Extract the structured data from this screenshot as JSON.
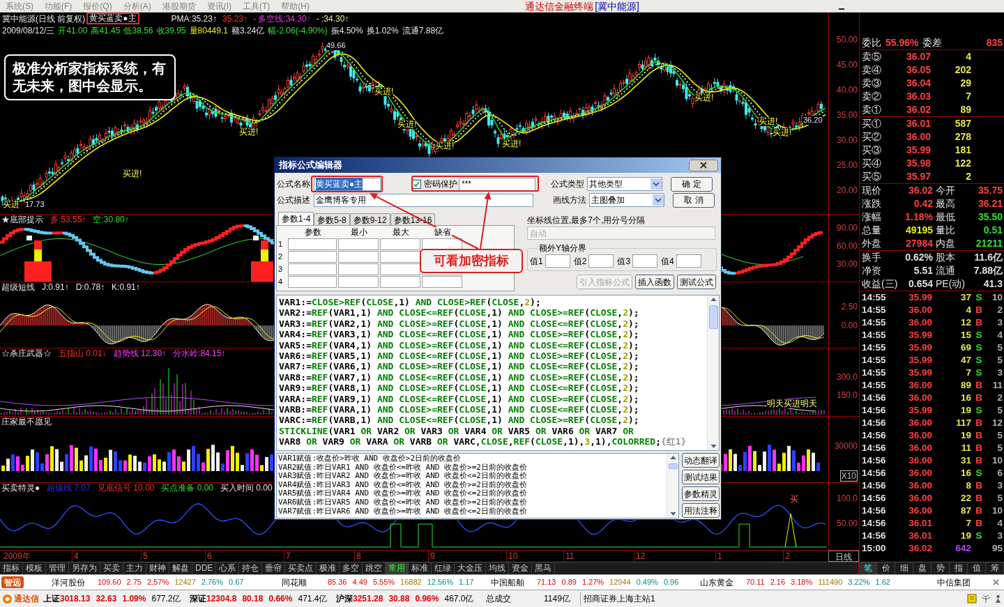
{
  "menu_bar": {
    "items": [
      "系统(S)",
      "功能(F)",
      "报价(Q)",
      "分析(A)",
      "港股期货",
      "资讯(I)",
      "工具(T)",
      "帮助(H)"
    ],
    "app_title": "通达信金融终端",
    "stock_title": "[冀中能源]"
  },
  "main_chart": {
    "title": "冀中能源(日线 前复权)",
    "formula_tag": "黄买蓝卖●主",
    "indicators": [
      {
        "text": "PMA:35.23↑",
        "color": "#e8e8e8"
      },
      {
        "text": "35.23↑",
        "color": "#ff3030"
      },
      {
        "text": "- 多空线:34.30↑",
        "color": "#e040e0"
      },
      {
        "text": "- :34.30↑",
        "color": "#f0f0a0"
      }
    ],
    "quote": [
      {
        "text": "2009/08/12/三",
        "color": "#e8e8e8"
      },
      {
        "text": "开41.00",
        "color": "#30e030"
      },
      {
        "text": "高41.45",
        "color": "#30e030"
      },
      {
        "text": "低38.56",
        "color": "#30e030"
      },
      {
        "text": "收39.95",
        "color": "#30e030"
      },
      {
        "text": "量80449.1",
        "color": "#f0f000"
      },
      {
        "text": "额3.24亿",
        "color": "#e8e8e8"
      },
      {
        "text": "幅-2.06(-4.90%)",
        "color": "#30e030"
      },
      {
        "text": "振4.50%",
        "color": "#e8e8e8"
      },
      {
        "text": "换1.02%",
        "color": "#e8e8e8"
      },
      {
        "text": "流通7.88亿",
        "color": "#e8e8e8"
      }
    ],
    "price_marks": [
      "49.66",
      "17.73",
      "36.20"
    ],
    "signals": [
      "买进!",
      "买进!",
      "买进!",
      "买进!",
      "买进!",
      "买进!",
      "买进!",
      "买进!",
      "买进!",
      "买进"
    ],
    "axis": [
      "50.00",
      "45.00",
      "40.00",
      "35.00",
      "30.00",
      "25.00",
      "20.00"
    ],
    "callout": "极准分析家指标系统，有无未来，图中会显示。"
  },
  "panels": [
    {
      "kind": "bottom",
      "title": "★底部提示",
      "values": [
        {
          "text": "多:53.55↑",
          "color": "#ff3030"
        },
        {
          "text": "空:30.80↑",
          "color": "#30e030"
        }
      ],
      "axis": [
        "90.00",
        "60.00",
        "30.00"
      ]
    },
    {
      "kind": "oscillator",
      "title": "超级短线",
      "values": [
        {
          "text": "J:0.91↑",
          "color": "#e8e8e8"
        },
        {
          "text": "D:0.78↑",
          "color": "#e8e8e8"
        },
        {
          "text": "K:0.91↑",
          "color": "#e8e8e8"
        }
      ],
      "axis": [
        "2.50",
        "0.00"
      ]
    },
    {
      "kind": "spikes",
      "title": "☆杀庄武器☆",
      "values": [
        {
          "text": "五指山 0.01↓",
          "color": "#ff3030"
        },
        {
          "text": "趋势线 12.30↑",
          "color": "#ff40ff"
        },
        {
          "text": "分水岭:84.15↑",
          "color": "#ff40ff"
        }
      ],
      "axis": [
        "300.0",
        "150.0"
      ],
      "labels": [
        "明天买进明天"
      ]
    },
    {
      "kind": "volume",
      "title": "庄家最不愿见",
      "axis": [
        "30000",
        "X10"
      ]
    },
    {
      "kind": "wave",
      "title": "买卖特灵●",
      "values": [
        {
          "text": "超级线 7.07",
          "color": "#2838e0"
        },
        {
          "text": "见底信号 10.00",
          "color": "#ff3030"
        },
        {
          "text": "买点准备 0.00",
          "color": "#30e030"
        },
        {
          "text": "买入时间 0.00",
          "color": "#e8e8e8"
        }
      ],
      "axis": [
        "100.0",
        "50.00"
      ],
      "labels": [
        "买"
      ]
    }
  ],
  "x_axis": {
    "year": "2009年",
    "months": [
      "4",
      "5",
      "6",
      "7",
      "8",
      "9",
      "10",
      "11",
      "12",
      "1",
      "2"
    ],
    "period": "日线"
  },
  "quote_panel": {
    "ratio_label": "委比",
    "ratio": "55.96%",
    "diff_label": "委差",
    "diff": "835",
    "asks": [
      {
        "label": "卖⑤",
        "price": "36.07",
        "volume": "4"
      },
      {
        "label": "卖④",
        "price": "36.05",
        "volume": "202"
      },
      {
        "label": "卖③",
        "price": "36.04",
        "volume": "29"
      },
      {
        "label": "卖②",
        "price": "36.03",
        "volume": "7"
      },
      {
        "label": "卖①",
        "price": "36.02",
        "volume": "89"
      }
    ],
    "bids": [
      {
        "label": "买①",
        "price": "36.01",
        "volume": "587"
      },
      {
        "label": "买②",
        "price": "36.00",
        "volume": "278"
      },
      {
        "label": "买③",
        "price": "35.99",
        "volume": "181"
      },
      {
        "label": "买④",
        "price": "35.98",
        "volume": "122"
      },
      {
        "label": "买⑤",
        "price": "35.97",
        "volume": "2"
      }
    ],
    "stats": [
      {
        "label": "现价",
        "value": "36.02",
        "color": "#ff4040"
      },
      {
        "label": "今开",
        "value": "35.75",
        "color": "#ff4040"
      },
      {
        "label": "涨跌",
        "value": "0.42",
        "color": "#ff4040"
      },
      {
        "label": "最高",
        "value": "36.21",
        "color": "#ff4040"
      },
      {
        "label": "涨幅",
        "value": "1.18%",
        "color": "#ff4040"
      },
      {
        "label": "最低",
        "value": "35.50",
        "color": "#30e030"
      },
      {
        "label": "总量",
        "value": "49195",
        "color": "#f0f000"
      },
      {
        "label": "量比",
        "value": "0.51",
        "color": "#30e030"
      },
      {
        "label": "外盘",
        "value": "27984",
        "color": "#ff4040"
      },
      {
        "label": "内盘",
        "value": "21211",
        "color": "#30e030"
      }
    ],
    "fundamentals": [
      {
        "label": "换手",
        "value": "0.62%"
      },
      {
        "label": "股本",
        "value": "11.6亿"
      },
      {
        "label": "净资",
        "value": "5.51"
      },
      {
        "label": "流通",
        "value": "7.88亿"
      },
      {
        "label": "收益(三)",
        "value": "0.654"
      },
      {
        "label": "PE(动)",
        "value": "41.3"
      }
    ],
    "trades": [
      {
        "time": "14:55",
        "price": "35.99",
        "volume": "37",
        "side": "S",
        "count": "10",
        "kind": "sell"
      },
      {
        "time": "14:55",
        "price": "36.00",
        "volume": "4",
        "side": "B",
        "count": "2",
        "kind": "buy"
      },
      {
        "time": "14:55",
        "price": "36.00",
        "volume": "12",
        "side": "B",
        "count": "3",
        "kind": "buy"
      },
      {
        "time": "14:55",
        "price": "35.99",
        "volume": "15",
        "side": "S",
        "count": "4",
        "kind": "sell"
      },
      {
        "time": "14:55",
        "price": "35.99",
        "volume": "69",
        "side": "S",
        "count": "5",
        "kind": "sell"
      },
      {
        "time": "14:55",
        "price": "35.99",
        "volume": "47",
        "side": "S",
        "count": "5",
        "kind": "sell"
      },
      {
        "time": "14:55",
        "price": "35.99",
        "volume": "7",
        "side": "S",
        "count": "3",
        "kind": "sell"
      },
      {
        "time": "14:55",
        "price": "36.00",
        "volume": "89",
        "side": "B",
        "count": "11",
        "kind": "buy"
      },
      {
        "time": "14:56",
        "price": "36.00",
        "volume": "16",
        "side": "B",
        "count": "2",
        "kind": "buy"
      },
      {
        "time": "14:56",
        "price": "35.99",
        "volume": "19",
        "side": "S",
        "count": "5",
        "kind": "sell"
      },
      {
        "time": "14:56",
        "price": "36.00",
        "volume": "117",
        "side": "B",
        "count": "12",
        "kind": "buy"
      },
      {
        "time": "14:56",
        "price": "36.00",
        "volume": "19",
        "side": "B",
        "count": "5",
        "kind": "buy"
      },
      {
        "time": "14:56",
        "price": "36.00",
        "volume": "11",
        "side": "B",
        "count": "5",
        "kind": "buy"
      },
      {
        "time": "14:56",
        "price": "36.00",
        "volume": "31",
        "side": "B",
        "count": "10",
        "kind": "buy"
      },
      {
        "time": "14:56",
        "price": "36.00",
        "volume": "16",
        "side": "S",
        "count": "6",
        "kind": "sell"
      },
      {
        "time": "14:56",
        "price": "36.00",
        "volume": "8",
        "side": "B",
        "count": "3",
        "kind": "buy"
      },
      {
        "time": "14:56",
        "price": "36.00",
        "volume": "22",
        "side": "B",
        "count": "5",
        "kind": "buy"
      },
      {
        "time": "14:56",
        "price": "36.00",
        "volume": "87",
        "side": "B",
        "count": "10",
        "kind": "buy"
      },
      {
        "time": "14:56",
        "price": "36.01",
        "volume": "7",
        "side": "B",
        "count": "4",
        "kind": "buy"
      },
      {
        "time": "14:56",
        "price": "36.01",
        "volume": "19",
        "side": "S",
        "count": "3",
        "kind": "sell"
      },
      {
        "time": "15:00",
        "price": "36.02",
        "volume": "642",
        "count": "95",
        "kind": "total"
      }
    ],
    "tabs": [
      {
        "label": "笔",
        "selected": true
      },
      {
        "label": "价",
        "selected": false
      },
      {
        "label": "细",
        "selected": false
      },
      {
        "label": "盘",
        "selected": false
      },
      {
        "label": "势",
        "selected": false
      },
      {
        "label": "指",
        "selected": false
      },
      {
        "label": "值",
        "selected": false
      },
      {
        "label": "筹",
        "selected": false
      }
    ]
  },
  "bottom_tabs": [
    {
      "label": "指标",
      "selected": false
    },
    {
      "label": "模板",
      "selected": false
    },
    {
      "label": "管理",
      "selected": false
    },
    {
      "label": "另存为",
      "selected": false
    },
    {
      "label": "买卖",
      "selected": false
    },
    {
      "label": "主力",
      "selected": false
    },
    {
      "label": "财神",
      "selected": false
    },
    {
      "label": "解盘",
      "selected": false
    },
    {
      "label": "DDE",
      "selected": false
    },
    {
      "label": "心系",
      "selected": false
    },
    {
      "label": "持仓",
      "selected": false
    },
    {
      "label": "垂帘",
      "selected": false
    },
    {
      "label": "买卖点",
      "selected": false
    },
    {
      "label": "极准",
      "selected": false
    },
    {
      "label": "多空",
      "selected": false
    },
    {
      "label": "跳空",
      "selected": false
    },
    {
      "label": "常用",
      "selected": true
    },
    {
      "label": "标准",
      "selected": false
    },
    {
      "label": "红绿",
      "selected": false
    },
    {
      "label": "大金压",
      "selected": false
    },
    {
      "label": "均线",
      "selected": false
    },
    {
      "label": "资金",
      "selected": false
    },
    {
      "label": "黑马",
      "selected": false
    }
  ],
  "ticker": {
    "logo": "智远",
    "items": [
      {
        "name": "洋河股份",
        "values": [
          "109.60",
          "2.75",
          "2.57%",
          "12427",
          "2.76%",
          "0.67"
        ]
      },
      {
        "name": "同花顺",
        "values": [
          "85.36",
          "4.49",
          "5.55%",
          "16882",
          "12.56%",
          "1.17"
        ]
      },
      {
        "name": "中国船舶",
        "values": [
          "71.13",
          "0.89",
          "1.27%",
          "12944",
          "0.49%",
          "0.96"
        ]
      },
      {
        "name": "山东黄金",
        "values": [
          "70.11",
          "2.16",
          "3.18%",
          "111490",
          "3.22%",
          "1.62"
        ]
      },
      {
        "name": "中信集团"
      }
    ]
  },
  "status_bar": {
    "logo": "通达信",
    "indices": [
      {
        "name": "上证",
        "value": "3018.13",
        "change": "32.63",
        "percent": "1.09%",
        "amount": "677.2亿"
      },
      {
        "name": "深证",
        "value": "12304.8",
        "change": "80.18",
        "percent": "0.66%",
        "amount": "471.4亿"
      },
      {
        "name": "沪深",
        "value": "3251.28",
        "change": "30.88",
        "percent": "0.96%",
        "amount": "467.0亿"
      }
    ],
    "total_label": "总成交",
    "total": "1149亿",
    "server": "招商证券上海主站1"
  },
  "dialog": {
    "title": "指标公式编辑器",
    "name": {
      "label": "公式名称",
      "value": "黄买蓝卖●主",
      "text_selected": true
    },
    "password": {
      "label": "密码保护",
      "checked": true,
      "value": "***"
    },
    "type": {
      "label": "公式类型",
      "value": "其他类型"
    },
    "description": {
      "label": "公式描述",
      "value": "金鹰博客专用"
    },
    "draw_method": {
      "label": "画线方法",
      "value": "主图叠加"
    },
    "buttons": [
      "确 定",
      "取 消"
    ],
    "param_tabs": [
      {
        "label": "参数1-4",
        "selected": true
      },
      {
        "label": "参数5-8",
        "selected": false
      },
      {
        "label": "参数9-12",
        "selected": false
      },
      {
        "label": "参数13-16",
        "selected": false
      }
    ],
    "param_headers": [
      "参数",
      "最小",
      "最大",
      "缺省"
    ],
    "param_rows": [
      "1",
      "2",
      "3",
      "4"
    ],
    "axis_label": "坐标线位置,最多7个,用分号分隔",
    "axis_placeholder": "自动",
    "y_group": {
      "title": "额外Y轴分界",
      "fields": [
        "值1",
        "值2",
        "值3",
        "值4"
      ]
    },
    "actions": [
      {
        "label": "引入指标公式",
        "disabled": true
      },
      {
        "label": "插入函数",
        "disabled": false
      },
      {
        "label": "测试公式",
        "disabled": false
      }
    ],
    "code": [
      [
        {
          "text": "VAR1:=",
          "kind": "plain"
        },
        {
          "text": "CLOSE>REF",
          "kind": "keyword"
        },
        {
          "text": "(",
          "kind": "plain"
        },
        {
          "text": "CLOSE",
          "kind": "keyword"
        },
        {
          "text": ",1) ",
          "kind": "plain"
        },
        {
          "text": "AND CLOSE>REF",
          "kind": "keyword"
        },
        {
          "text": "(",
          "kind": "plain"
        },
        {
          "text": "CLOSE",
          "kind": "keyword"
        },
        {
          "text": ",",
          "kind": "plain"
        },
        {
          "text": "2",
          "kind": "number"
        },
        {
          "text": ");",
          "kind": "plain"
        }
      ],
      [
        {
          "text": "VAR2:=",
          "kind": "plain"
        },
        {
          "text": "REF",
          "kind": "keyword"
        },
        {
          "text": "(VAR1,1) ",
          "kind": "plain"
        },
        {
          "text": "AND CLOSE<=REF",
          "kind": "keyword"
        },
        {
          "text": "(",
          "kind": "plain"
        },
        {
          "text": "CLOSE",
          "kind": "keyword"
        },
        {
          "text": ",1) ",
          "kind": "plain"
        },
        {
          "text": "AND CLOSE>=REF",
          "kind": "keyword"
        },
        {
          "text": "(",
          "kind": "plain"
        },
        {
          "text": "CLOSE",
          "kind": "keyword"
        },
        {
          "text": ",",
          "kind": "plain"
        },
        {
          "text": "2",
          "kind": "number"
        },
        {
          "text": ");",
          "kind": "plain"
        }
      ],
      [
        {
          "text": "VAR3:=",
          "kind": "plain"
        },
        {
          "text": "REF",
          "kind": "keyword"
        },
        {
          "text": "(VAR2,1) ",
          "kind": "plain"
        },
        {
          "text": "AND CLOSE>=REF",
          "kind": "keyword"
        },
        {
          "text": "(",
          "kind": "plain"
        },
        {
          "text": "CLOSE",
          "kind": "keyword"
        },
        {
          "text": ",1) ",
          "kind": "plain"
        },
        {
          "text": "AND CLOSE<=REF",
          "kind": "keyword"
        },
        {
          "text": "(",
          "kind": "plain"
        },
        {
          "text": "CLOSE",
          "kind": "keyword"
        },
        {
          "text": ",",
          "kind": "plain"
        },
        {
          "text": "2",
          "kind": "number"
        },
        {
          "text": ");",
          "kind": "plain"
        }
      ],
      [
        {
          "text": "VAR4:=",
          "kind": "plain"
        },
        {
          "text": "REF",
          "kind": "keyword"
        },
        {
          "text": "(VAR3,1) ",
          "kind": "plain"
        },
        {
          "text": "AND CLOSE<=REF",
          "kind": "keyword"
        },
        {
          "text": "(",
          "kind": "plain"
        },
        {
          "text": "CLOSE",
          "kind": "keyword"
        },
        {
          "text": ",1) ",
          "kind": "plain"
        },
        {
          "text": "AND CLOSE>=REF",
          "kind": "keyword"
        },
        {
          "text": "(",
          "kind": "plain"
        },
        {
          "text": "CLOSE",
          "kind": "keyword"
        },
        {
          "text": ",",
          "kind": "plain"
        },
        {
          "text": "2",
          "kind": "number"
        },
        {
          "text": ");",
          "kind": "plain"
        }
      ],
      [
        {
          "text": "VAR5:=",
          "kind": "plain"
        },
        {
          "text": "REF",
          "kind": "keyword"
        },
        {
          "text": "(VAR4,1) ",
          "kind": "plain"
        },
        {
          "text": "AND CLOSE>=REF",
          "kind": "keyword"
        },
        {
          "text": "(",
          "kind": "plain"
        },
        {
          "text": "CLOSE",
          "kind": "keyword"
        },
        {
          "text": ",1) ",
          "kind": "plain"
        },
        {
          "text": "AND CLOSE<=REF",
          "kind": "keyword"
        },
        {
          "text": "(",
          "kind": "plain"
        },
        {
          "text": "CLOSE",
          "kind": "keyword"
        },
        {
          "text": ",",
          "kind": "plain"
        },
        {
          "text": "2",
          "kind": "number"
        },
        {
          "text": ");",
          "kind": "plain"
        }
      ],
      [
        {
          "text": "VAR6:=",
          "kind": "plain"
        },
        {
          "text": "REF",
          "kind": "keyword"
        },
        {
          "text": "(VAR5,1) ",
          "kind": "plain"
        },
        {
          "text": "AND CLOSE<=REF",
          "kind": "keyword"
        },
        {
          "text": "(",
          "kind": "plain"
        },
        {
          "text": "CLOSE",
          "kind": "keyword"
        },
        {
          "text": ",1) ",
          "kind": "plain"
        },
        {
          "text": "AND CLOSE>=REF",
          "kind": "keyword"
        },
        {
          "text": "(",
          "kind": "plain"
        },
        {
          "text": "CLOSE",
          "kind": "keyword"
        },
        {
          "text": ",",
          "kind": "plain"
        },
        {
          "text": "2",
          "kind": "number"
        },
        {
          "text": ");",
          "kind": "plain"
        }
      ],
      [
        {
          "text": "VAR7:=",
          "kind": "plain"
        },
        {
          "text": "REF",
          "kind": "keyword"
        },
        {
          "text": "(VAR6,1) ",
          "kind": "plain"
        },
        {
          "text": "AND CLOSE>=REF",
          "kind": "keyword"
        },
        {
          "text": "(",
          "kind": "plain"
        },
        {
          "text": "CLOSE",
          "kind": "keyword"
        },
        {
          "text": ",1) ",
          "kind": "plain"
        },
        {
          "text": "AND CLOSE<=REF",
          "kind": "keyword"
        },
        {
          "text": "(",
          "kind": "plain"
        },
        {
          "text": "CLOSE",
          "kind": "keyword"
        },
        {
          "text": ",",
          "kind": "plain"
        },
        {
          "text": "2",
          "kind": "number"
        },
        {
          "text": ");",
          "kind": "plain"
        }
      ],
      [
        {
          "text": "VAR8:=",
          "kind": "plain"
        },
        {
          "text": "REF",
          "kind": "keyword"
        },
        {
          "text": "(VAR7,1) ",
          "kind": "plain"
        },
        {
          "text": "AND CLOSE<=REF",
          "kind": "keyword"
        },
        {
          "text": "(",
          "kind": "plain"
        },
        {
          "text": "CLOSE",
          "kind": "keyword"
        },
        {
          "text": ",1) ",
          "kind": "plain"
        },
        {
          "text": "AND CLOSE>=REF",
          "kind": "keyword"
        },
        {
          "text": "(",
          "kind": "plain"
        },
        {
          "text": "CLOSE",
          "kind": "keyword"
        },
        {
          "text": ",",
          "kind": "plain"
        },
        {
          "text": "2",
          "kind": "number"
        },
        {
          "text": ");",
          "kind": "plain"
        }
      ],
      [
        {
          "text": "VAR9:=",
          "kind": "plain"
        },
        {
          "text": "REF",
          "kind": "keyword"
        },
        {
          "text": "(VAR8,1) ",
          "kind": "plain"
        },
        {
          "text": "AND CLOSE>=REF",
          "kind": "keyword"
        },
        {
          "text": "(",
          "kind": "plain"
        },
        {
          "text": "CLOSE",
          "kind": "keyword"
        },
        {
          "text": ",1) ",
          "kind": "plain"
        },
        {
          "text": "AND CLOSE<=REF",
          "kind": "keyword"
        },
        {
          "text": "(",
          "kind": "plain"
        },
        {
          "text": "CLOSE",
          "kind": "keyword"
        },
        {
          "text": ",",
          "kind": "plain"
        },
        {
          "text": "2",
          "kind": "number"
        },
        {
          "text": ");",
          "kind": "plain"
        }
      ],
      [
        {
          "text": "VARA:=",
          "kind": "plain"
        },
        {
          "text": "REF",
          "kind": "keyword"
        },
        {
          "text": "(VAR9,1) ",
          "kind": "plain"
        },
        {
          "text": "AND CLOSE<=REF",
          "kind": "keyword"
        },
        {
          "text": "(",
          "kind": "plain"
        },
        {
          "text": "CLOSE",
          "kind": "keyword"
        },
        {
          "text": ",1) ",
          "kind": "plain"
        },
        {
          "text": "AND CLOSE>=REF",
          "kind": "keyword"
        },
        {
          "text": "(",
          "kind": "plain"
        },
        {
          "text": "CLOSE",
          "kind": "keyword"
        },
        {
          "text": ",",
          "kind": "plain"
        },
        {
          "text": "2",
          "kind": "number"
        },
        {
          "text": ");",
          "kind": "plain"
        }
      ],
      [
        {
          "text": "VARB:=",
          "kind": "plain"
        },
        {
          "text": "REF",
          "kind": "keyword"
        },
        {
          "text": "(VARA,1) ",
          "kind": "plain"
        },
        {
          "text": "AND CLOSE>=REF",
          "kind": "keyword"
        },
        {
          "text": "(",
          "kind": "plain"
        },
        {
          "text": "CLOSE",
          "kind": "keyword"
        },
        {
          "text": ",1) ",
          "kind": "plain"
        },
        {
          "text": "AND CLOSE<=REF",
          "kind": "keyword"
        },
        {
          "text": "(",
          "kind": "plain"
        },
        {
          "text": "CLOSE",
          "kind": "keyword"
        },
        {
          "text": ",",
          "kind": "plain"
        },
        {
          "text": "2",
          "kind": "number"
        },
        {
          "text": ");",
          "kind": "plain"
        }
      ],
      [
        {
          "text": "VARC:=",
          "kind": "plain"
        },
        {
          "text": "REF",
          "kind": "keyword"
        },
        {
          "text": "(VARB,1) ",
          "kind": "plain"
        },
        {
          "text": "AND CLOSE<=REF",
          "kind": "keyword"
        },
        {
          "text": "(",
          "kind": "plain"
        },
        {
          "text": "CLOSE",
          "kind": "keyword"
        },
        {
          "text": ",1) ",
          "kind": "plain"
        },
        {
          "text": "AND CLOSE>=REF",
          "kind": "keyword"
        },
        {
          "text": "(",
          "kind": "plain"
        },
        {
          "text": "CLOSE",
          "kind": "keyword"
        },
        {
          "text": ",",
          "kind": "plain"
        },
        {
          "text": "2",
          "kind": "number"
        },
        {
          "text": ");",
          "kind": "plain"
        }
      ],
      [
        {
          "text": "STICKLINE",
          "kind": "keyword"
        },
        {
          "text": "(VAR1 ",
          "kind": "plain"
        },
        {
          "text": "OR",
          "kind": "keyword"
        },
        {
          "text": " VAR2 ",
          "kind": "plain"
        },
        {
          "text": "OR",
          "kind": "keyword"
        },
        {
          "text": " VAR3 ",
          "kind": "plain"
        },
        {
          "text": "OR",
          "kind": "keyword"
        },
        {
          "text": " VAR4 ",
          "kind": "plain"
        },
        {
          "text": "OR",
          "kind": "keyword"
        },
        {
          "text": " VAR5 ",
          "kind": "plain"
        },
        {
          "text": "OR",
          "kind": "keyword"
        },
        {
          "text": " VAR6 ",
          "kind": "plain"
        },
        {
          "text": "OR",
          "kind": "keyword"
        },
        {
          "text": " VAR7 ",
          "kind": "plain"
        },
        {
          "text": "OR",
          "kind": "keyword"
        }
      ],
      [
        {
          "text": "VAR8 ",
          "kind": "plain"
        },
        {
          "text": "OR",
          "kind": "keyword"
        },
        {
          "text": " VAR9 ",
          "kind": "plain"
        },
        {
          "text": "OR",
          "kind": "keyword"
        },
        {
          "text": " VARA ",
          "kind": "plain"
        },
        {
          "text": "OR",
          "kind": "keyword"
        },
        {
          "text": " VARB ",
          "kind": "plain"
        },
        {
          "text": "OR",
          "kind": "keyword"
        },
        {
          "text": " VARC,",
          "kind": "plain"
        },
        {
          "text": "CLOSE",
          "kind": "keyword"
        },
        {
          "text": ",",
          "kind": "plain"
        },
        {
          "text": "REF",
          "kind": "keyword"
        },
        {
          "text": "(",
          "kind": "plain"
        },
        {
          "text": "CLOSE",
          "kind": "keyword"
        },
        {
          "text": ",1),",
          "kind": "plain"
        },
        {
          "text": "3",
          "kind": "number"
        },
        {
          "text": ",1),",
          "kind": "plain"
        },
        {
          "text": "COLORRED",
          "kind": "keyword"
        },
        {
          "text": ";",
          "kind": "plain"
        },
        {
          "text": "{红1}",
          "kind": "comment"
        }
      ]
    ],
    "notes": [
      "VAR1赋值:收盘价>昨收 AND 收盘价>2日前的收盘价",
      "VAR2赋值:昨日VAR1 AND 收盘价<=昨收 AND 收盘价>=2日前的收盘价",
      "VAR3赋值:昨日VAR2 AND 收盘价>=昨收 AND 收盘价<=2日前的收盘价",
      "VAR4赋值:昨日VAR3 AND 收盘价<=昨收 AND 收盘价>=2日前的收盘价",
      "VAR5赋值:昨日VAR4 AND 收盘价>=昨收 AND 收盘价<=2日前的收盘价",
      "VAR6赋值:昨日VAR5 AND 收盘价<=昨收 AND 收盘价>=2日前的收盘价",
      "VAR7赋值:昨日VAR6 AND 收盘价>=昨收 AND 收盘价<=2日前的收盘价"
    ],
    "side_buttons": [
      "动态翻译",
      "测试结果",
      "参数精灵",
      "用法注释"
    ],
    "callout": "可看加密指标"
  }
}
